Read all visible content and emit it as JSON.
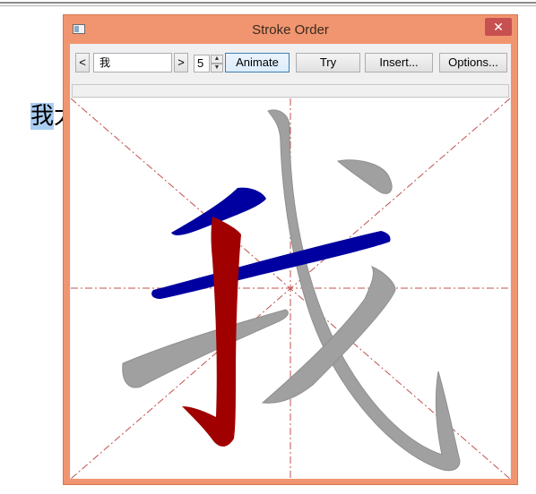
{
  "background_doc": {
    "highlighted_char": "我",
    "trailing_text": "太"
  },
  "window": {
    "title": "Stroke Order",
    "close_glyph": "✕"
  },
  "toolbar": {
    "prev_label": "<",
    "character_value": "我",
    "next_label": ">",
    "stroke_count": "5",
    "spin_up": "▲",
    "spin_down": "▼",
    "animate_label": "Animate",
    "try_label": "Try",
    "insert_label": "Insert...",
    "options_label": "Options..."
  },
  "canvas": {
    "character": "我",
    "guide_color": "#c0504d",
    "stroke_colors": {
      "completed": "#0000a0",
      "current": "#a00000",
      "remaining": "#a0a0a0"
    }
  }
}
